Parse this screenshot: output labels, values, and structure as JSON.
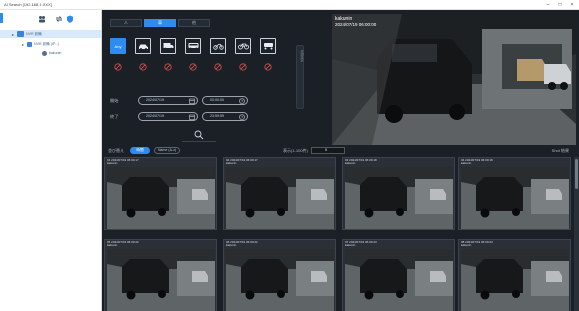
{
  "window": {
    "title": "AI Search [192.168.1.XXX]",
    "controls": {
      "minimize": "–",
      "maximize": "□",
      "close": "×"
    }
  },
  "tree": {
    "toolbar_icons": [
      "device-group-icon",
      "swap-icon",
      "shield-icon"
    ],
    "nodes": [
      {
        "label": "NVR 設備",
        "expanded": true,
        "selected": true
      },
      {
        "label": "NVR 設備 (IP...)",
        "expanded": true,
        "selected": false
      },
      {
        "label": "kakunin",
        "expanded": false,
        "selected": false
      }
    ]
  },
  "filter": {
    "mode_tabs": [
      {
        "label": "人",
        "active": false
      },
      {
        "label": "車",
        "active": true
      },
      {
        "label": "他",
        "active": false
      }
    ],
    "vehicle_types": [
      {
        "label": "Any",
        "icon": "any-icon",
        "active": true
      },
      {
        "label": "",
        "icon": "car-icon",
        "active": false
      },
      {
        "label": "",
        "icon": "truck-icon",
        "active": false
      },
      {
        "label": "",
        "icon": "bus-icon",
        "active": false
      },
      {
        "label": "",
        "icon": "motorcycle-icon",
        "active": false
      },
      {
        "label": "",
        "icon": "bicycle-icon",
        "active": false
      },
      {
        "label": "",
        "icon": "tricycle-icon",
        "active": false
      }
    ],
    "start_label": "開始",
    "end_label": "終了",
    "start_date": "2024/07/19",
    "start_time": "00:00:00",
    "end_date": "2024/07/19",
    "end_time": "23:59:59",
    "collapse_handle_label": "詳細設定"
  },
  "preview": {
    "caption_line1": "kakunin",
    "caption_line2": "2024/07/19 06:00:00"
  },
  "results": {
    "left_label": "並び替え",
    "sort_time_label": "時間",
    "sort_name_label": "Name (A-z)",
    "count_label": "表示(1-100件)",
    "count_value": "5",
    "right_label": "Shot 結果",
    "items": [
      {
        "line1": "01 2024/07/19 06:00:17",
        "line2": "kakunin"
      },
      {
        "line1": "02 2024/07/19 06:00:17",
        "line2": "kakunin"
      },
      {
        "line1": "03 2024/07/19 06:00:18",
        "line2": "kakunin"
      },
      {
        "line1": "04 2024/07/19 06:00:18",
        "line2": "kakunin"
      },
      {
        "line1": "05 2024/07/19 06:00:22",
        "line2": "kakunin"
      },
      {
        "line1": "06 2024/07/19 06:00:22",
        "line2": "kakunin"
      },
      {
        "line1": "07 2024/07/19 06:00:23",
        "line2": "kakunin"
      },
      {
        "line1": "08 2024/07/19 06:00:23",
        "line2": "kakunin"
      }
    ]
  },
  "colors": {
    "accent": "#2d8cf0",
    "panel_dark": "#1b2027",
    "tree_selected": "#d7e9fb"
  }
}
